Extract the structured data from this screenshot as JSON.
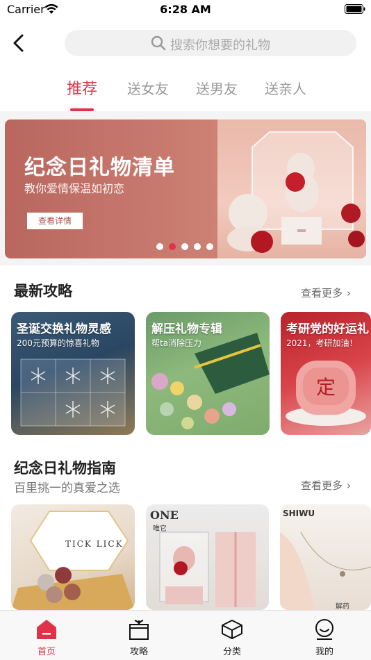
{
  "status_bar": {
    "carrier": "Carrier",
    "time": "6:28 AM"
  },
  "search": {
    "placeholder": "搜索你想要的礼物"
  },
  "tabs": [
    {
      "label": "推荐",
      "active": true
    },
    {
      "label": "送女友",
      "active": false
    },
    {
      "label": "送男友",
      "active": false
    },
    {
      "label": "送亲人",
      "active": false
    }
  ],
  "banner": {
    "title": "纪念日礼物清单",
    "subtitle": "教你爱情保温如初恋",
    "cta": "查看详情",
    "page_count": 5,
    "active_page": 2
  },
  "latest_guides": {
    "title": "最新攻略",
    "more": "查看更多",
    "cards": [
      {
        "title": "圣诞交换礼物灵感",
        "subtitle": "200元预算的惊喜礼物"
      },
      {
        "title": "解压礼物专辑",
        "subtitle": "帮ta消除压力"
      },
      {
        "title": "考研党的好运礼",
        "subtitle": "2021，考研加油！"
      }
    ]
  },
  "anniversary_guide": {
    "title": "纪念日礼物指南",
    "subtitle": "百里挑一的真爱之选",
    "more": "查看更多",
    "items": [
      {
        "label": "TICK LICK"
      },
      {
        "label": "ONE",
        "sub": "唯它"
      },
      {
        "label": "SHIWU",
        "sub": "解药"
      }
    ]
  },
  "tab_bar": [
    {
      "label": "首页",
      "icon": "home-icon",
      "active": true
    },
    {
      "label": "攻略",
      "icon": "gift-icon",
      "active": false
    },
    {
      "label": "分类",
      "icon": "category-icon",
      "active": false
    },
    {
      "label": "我的",
      "icon": "profile-icon",
      "active": false
    }
  ],
  "colors": {
    "accent": "#e0334a",
    "banner": "#c97a6f"
  }
}
